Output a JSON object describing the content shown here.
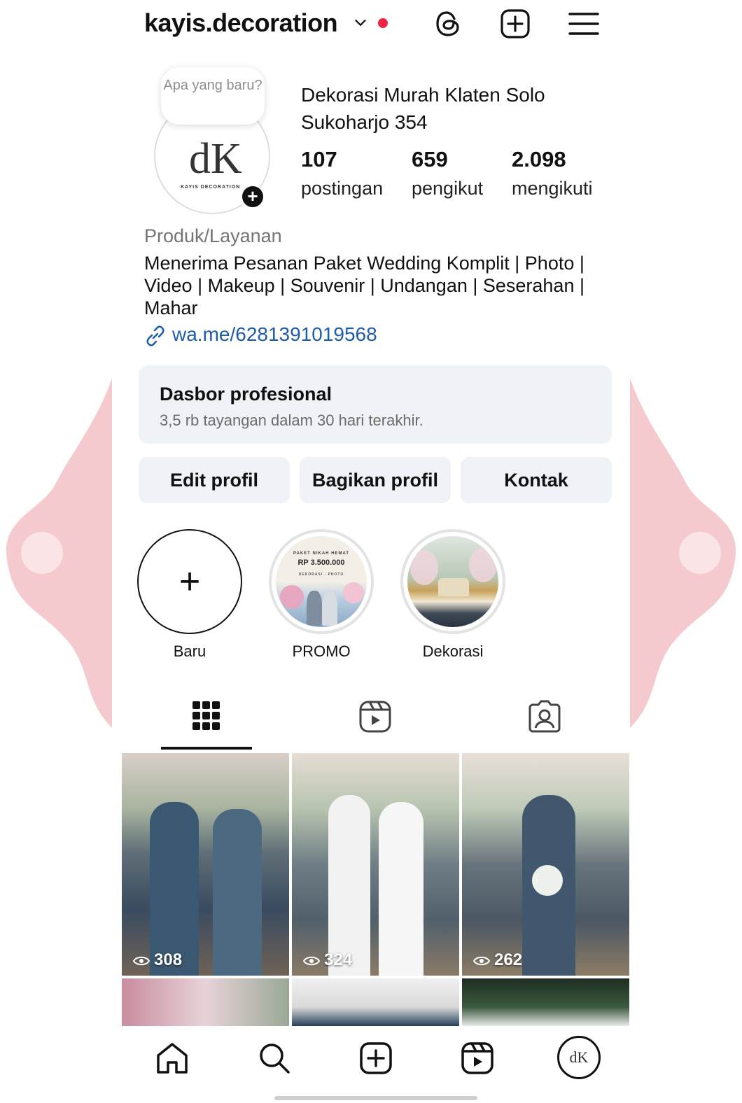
{
  "header": {
    "username": "kayis.decoration",
    "icons": [
      "chevron-down-icon",
      "threads-icon",
      "add-post-icon",
      "menu-icon"
    ],
    "notification_color": "#ed2543"
  },
  "profile": {
    "note": "Apa yang baru?",
    "logo_text": "dK",
    "logo_subtext": "KAYIS DECORATION",
    "display_name": "Dekorasi Murah Klaten Solo Sukoharjo 354",
    "stats": [
      {
        "value": "107",
        "label": "postingan"
      },
      {
        "value": "659",
        "label": "pengikut"
      },
      {
        "value": "2.098",
        "label": "mengikuti"
      }
    ],
    "category": "Produk/Layanan",
    "bio": "Menerima Pesanan Paket Wedding Komplit | Photo | Video | Makeup | Souvenir | Undangan | Seserahan | Mahar",
    "link": "wa.me/6281391019568"
  },
  "dashboard": {
    "title": "Dasbor profesional",
    "subtitle": "3,5 rb tayangan dalam 30 hari terakhir."
  },
  "buttons": {
    "edit": "Edit profil",
    "share": "Bagikan profil",
    "contact": "Kontak"
  },
  "highlights": [
    {
      "label": "Baru"
    },
    {
      "label": "PROMO",
      "line1": "PAKET NIKAH HEMAT",
      "line2": "RP 3.500.000",
      "line3": "DEKORASI - PHOTO"
    },
    {
      "label": "Dekorasi"
    }
  ],
  "tabs": [
    "grid-icon",
    "reels-icon",
    "tagged-icon"
  ],
  "posts": [
    {
      "views": "308"
    },
    {
      "views": "324"
    },
    {
      "views": "262"
    }
  ],
  "bottom_nav": [
    "home-icon",
    "search-icon",
    "create-icon",
    "reels-icon",
    "profile-avatar"
  ],
  "colors": {
    "link": "#1e5ca8",
    "card_bg": "#eff2f6",
    "notification": "#ed2543"
  }
}
